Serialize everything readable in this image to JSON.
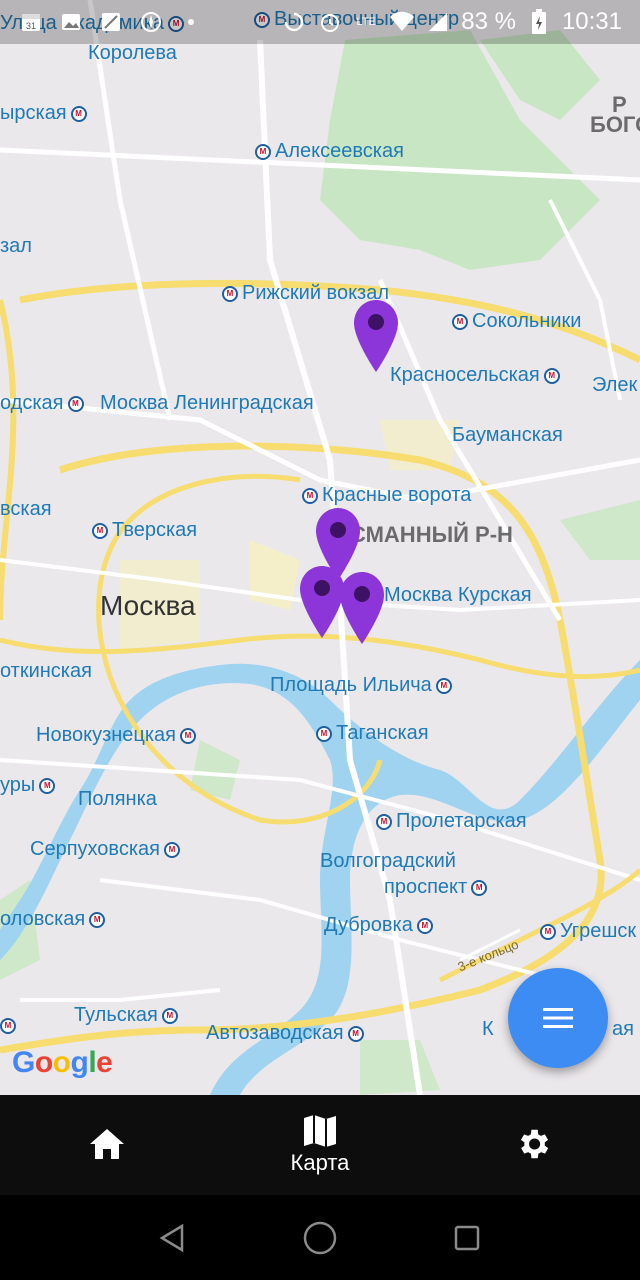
{
  "status_bar": {
    "battery": "83 %",
    "time": "10:31",
    "network": "LTE",
    "icons": [
      "calendar-icon",
      "image-icon",
      "gallery-icon",
      "compass-icon",
      "dot-icon",
      "sync-icon",
      "alarm-icon",
      "volte-icon",
      "wifi-icon",
      "signal-icon",
      "battery-icon"
    ]
  },
  "map": {
    "city_label": "Москва",
    "district_label": "СМАННЫЙ Р-Н",
    "top_right_label_1": "Р",
    "top_right_label_2": "БОГО",
    "ring_label": "3-е кольцо",
    "google_logo": "Google",
    "metro_stations": [
      {
        "name": "Улица Академика"
      },
      {
        "name": "Выставочный центр"
      },
      {
        "name": "Королева"
      },
      {
        "name": "ырская"
      },
      {
        "name": "Алексеевская"
      },
      {
        "name": "зал"
      },
      {
        "name": "Рижский вокзал"
      },
      {
        "name": "Сокольники"
      },
      {
        "name": "Красносельская"
      },
      {
        "name": "Элек"
      },
      {
        "name": "одская"
      },
      {
        "name": "Москва Ленинградская"
      },
      {
        "name": "Бауманская"
      },
      {
        "name": "Красные ворота"
      },
      {
        "name": "вская"
      },
      {
        "name": "Тверская"
      },
      {
        "name": "Москва Курская"
      },
      {
        "name": "откинская"
      },
      {
        "name": "Площадь Ильича"
      },
      {
        "name": "Новокузнецкая"
      },
      {
        "name": "Таганская"
      },
      {
        "name": "уры"
      },
      {
        "name": "Полянка"
      },
      {
        "name": "Пролетарская"
      },
      {
        "name": "Серпуховская"
      },
      {
        "name": "Волгоградский"
      },
      {
        "name": "проспект"
      },
      {
        "name": "оловская"
      },
      {
        "name": "Дубровка"
      },
      {
        "name": "Угрешск"
      },
      {
        "name": "Тульская"
      },
      {
        "name": "Автозаводская"
      },
      {
        "name": "К"
      },
      {
        "name": "ая"
      }
    ],
    "markers": [
      {
        "name": "marker-1"
      },
      {
        "name": "marker-2"
      },
      {
        "name": "marker-3"
      },
      {
        "name": "marker-4"
      }
    ],
    "marker_color": "#8c35d8"
  },
  "fab": {
    "icon": "menu-icon",
    "color": "#3d8cf4"
  },
  "bottom_nav": {
    "items": [
      {
        "icon": "home-icon",
        "label": ""
      },
      {
        "icon": "map-icon",
        "label": "Карта"
      },
      {
        "icon": "gear-icon",
        "label": ""
      }
    ]
  },
  "system_nav": {
    "icons": [
      "back-icon",
      "home-circle-icon",
      "recents-icon"
    ]
  }
}
